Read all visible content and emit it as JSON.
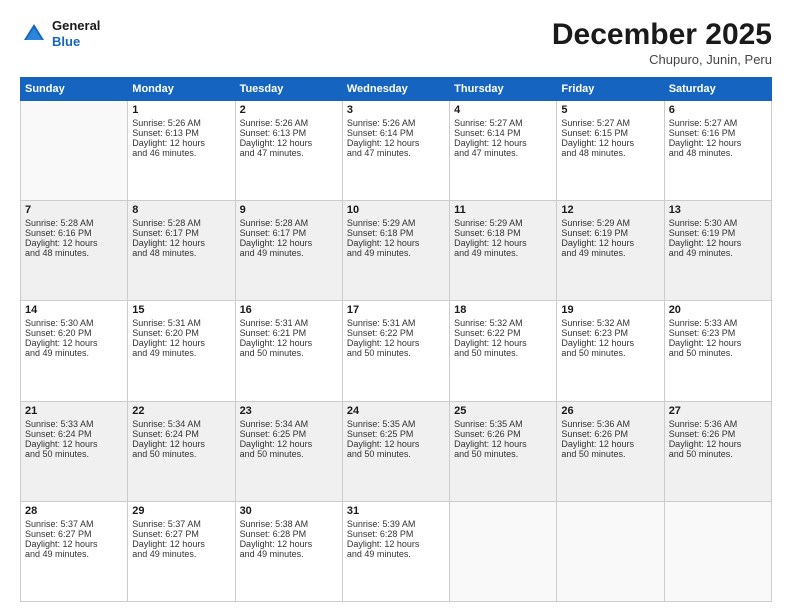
{
  "header": {
    "logo_line1": "General",
    "logo_line2": "Blue",
    "month": "December 2025",
    "location": "Chupuro, Junin, Peru"
  },
  "weekdays": [
    "Sunday",
    "Monday",
    "Tuesday",
    "Wednesday",
    "Thursday",
    "Friday",
    "Saturday"
  ],
  "weeks": [
    [
      {
        "day": "",
        "info": ""
      },
      {
        "day": "1",
        "info": "Sunrise: 5:26 AM\nSunset: 6:13 PM\nDaylight: 12 hours\nand 46 minutes."
      },
      {
        "day": "2",
        "info": "Sunrise: 5:26 AM\nSunset: 6:13 PM\nDaylight: 12 hours\nand 47 minutes."
      },
      {
        "day": "3",
        "info": "Sunrise: 5:26 AM\nSunset: 6:14 PM\nDaylight: 12 hours\nand 47 minutes."
      },
      {
        "day": "4",
        "info": "Sunrise: 5:27 AM\nSunset: 6:14 PM\nDaylight: 12 hours\nand 47 minutes."
      },
      {
        "day": "5",
        "info": "Sunrise: 5:27 AM\nSunset: 6:15 PM\nDaylight: 12 hours\nand 48 minutes."
      },
      {
        "day": "6",
        "info": "Sunrise: 5:27 AM\nSunset: 6:16 PM\nDaylight: 12 hours\nand 48 minutes."
      }
    ],
    [
      {
        "day": "7",
        "info": "Sunrise: 5:28 AM\nSunset: 6:16 PM\nDaylight: 12 hours\nand 48 minutes."
      },
      {
        "day": "8",
        "info": "Sunrise: 5:28 AM\nSunset: 6:17 PM\nDaylight: 12 hours\nand 48 minutes."
      },
      {
        "day": "9",
        "info": "Sunrise: 5:28 AM\nSunset: 6:17 PM\nDaylight: 12 hours\nand 49 minutes."
      },
      {
        "day": "10",
        "info": "Sunrise: 5:29 AM\nSunset: 6:18 PM\nDaylight: 12 hours\nand 49 minutes."
      },
      {
        "day": "11",
        "info": "Sunrise: 5:29 AM\nSunset: 6:18 PM\nDaylight: 12 hours\nand 49 minutes."
      },
      {
        "day": "12",
        "info": "Sunrise: 5:29 AM\nSunset: 6:19 PM\nDaylight: 12 hours\nand 49 minutes."
      },
      {
        "day": "13",
        "info": "Sunrise: 5:30 AM\nSunset: 6:19 PM\nDaylight: 12 hours\nand 49 minutes."
      }
    ],
    [
      {
        "day": "14",
        "info": "Sunrise: 5:30 AM\nSunset: 6:20 PM\nDaylight: 12 hours\nand 49 minutes."
      },
      {
        "day": "15",
        "info": "Sunrise: 5:31 AM\nSunset: 6:20 PM\nDaylight: 12 hours\nand 49 minutes."
      },
      {
        "day": "16",
        "info": "Sunrise: 5:31 AM\nSunset: 6:21 PM\nDaylight: 12 hours\nand 50 minutes."
      },
      {
        "day": "17",
        "info": "Sunrise: 5:31 AM\nSunset: 6:22 PM\nDaylight: 12 hours\nand 50 minutes."
      },
      {
        "day": "18",
        "info": "Sunrise: 5:32 AM\nSunset: 6:22 PM\nDaylight: 12 hours\nand 50 minutes."
      },
      {
        "day": "19",
        "info": "Sunrise: 5:32 AM\nSunset: 6:23 PM\nDaylight: 12 hours\nand 50 minutes."
      },
      {
        "day": "20",
        "info": "Sunrise: 5:33 AM\nSunset: 6:23 PM\nDaylight: 12 hours\nand 50 minutes."
      }
    ],
    [
      {
        "day": "21",
        "info": "Sunrise: 5:33 AM\nSunset: 6:24 PM\nDaylight: 12 hours\nand 50 minutes."
      },
      {
        "day": "22",
        "info": "Sunrise: 5:34 AM\nSunset: 6:24 PM\nDaylight: 12 hours\nand 50 minutes."
      },
      {
        "day": "23",
        "info": "Sunrise: 5:34 AM\nSunset: 6:25 PM\nDaylight: 12 hours\nand 50 minutes."
      },
      {
        "day": "24",
        "info": "Sunrise: 5:35 AM\nSunset: 6:25 PM\nDaylight: 12 hours\nand 50 minutes."
      },
      {
        "day": "25",
        "info": "Sunrise: 5:35 AM\nSunset: 6:26 PM\nDaylight: 12 hours\nand 50 minutes."
      },
      {
        "day": "26",
        "info": "Sunrise: 5:36 AM\nSunset: 6:26 PM\nDaylight: 12 hours\nand 50 minutes."
      },
      {
        "day": "27",
        "info": "Sunrise: 5:36 AM\nSunset: 6:26 PM\nDaylight: 12 hours\nand 50 minutes."
      }
    ],
    [
      {
        "day": "28",
        "info": "Sunrise: 5:37 AM\nSunset: 6:27 PM\nDaylight: 12 hours\nand 49 minutes."
      },
      {
        "day": "29",
        "info": "Sunrise: 5:37 AM\nSunset: 6:27 PM\nDaylight: 12 hours\nand 49 minutes."
      },
      {
        "day": "30",
        "info": "Sunrise: 5:38 AM\nSunset: 6:28 PM\nDaylight: 12 hours\nand 49 minutes."
      },
      {
        "day": "31",
        "info": "Sunrise: 5:39 AM\nSunset: 6:28 PM\nDaylight: 12 hours\nand 49 minutes."
      },
      {
        "day": "",
        "info": ""
      },
      {
        "day": "",
        "info": ""
      },
      {
        "day": "",
        "info": ""
      }
    ]
  ]
}
